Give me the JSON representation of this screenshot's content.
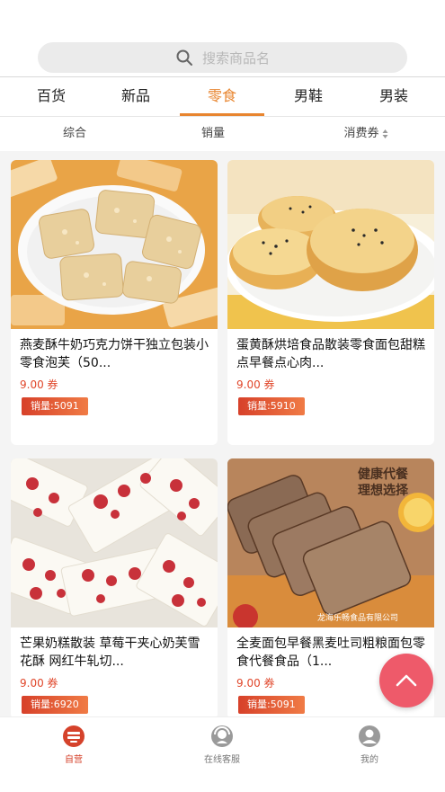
{
  "search": {
    "placeholder": "搜索商品名"
  },
  "tabs": [
    {
      "label": "百货"
    },
    {
      "label": "新品"
    },
    {
      "label": "零食",
      "active": true
    },
    {
      "label": "男鞋"
    },
    {
      "label": "男装"
    }
  ],
  "sort_options": [
    {
      "label": "综合"
    },
    {
      "label": "销量"
    },
    {
      "label": "消费券"
    }
  ],
  "products": [
    {
      "title": "燕麦酥牛奶巧克力饼干独立包装小零食泡芙（50...",
      "price": "9.00 券",
      "sales": "销量:5091"
    },
    {
      "title": "蛋黄酥烘培食品散装零食面包甜糕点早餐点心肉...",
      "price": "9.00 券",
      "sales": "销量:5910"
    },
    {
      "title": "芒果奶糕散装 草莓干夹心奶芙雪花酥 网红牛轧切...",
      "price": "9.00 券",
      "sales": "销量:6920"
    },
    {
      "title": "全麦面包早餐黑麦吐司粗粮面包零食代餐食品（1...",
      "price": "9.00 券",
      "sales": "销量:5091",
      "img_text_1": "健康代餐",
      "img_text_2": "理想选择",
      "img_watermark": "龙海乐畅食品有限公司"
    }
  ],
  "bottom_nav": [
    {
      "label": "自营",
      "icon": "store-icon",
      "active": true
    },
    {
      "label": "在线客服",
      "icon": "customer-service-icon"
    },
    {
      "label": "我的",
      "icon": "user-icon"
    }
  ],
  "colors": {
    "accent": "#e8852f",
    "price": "#e0462a",
    "fab": "#ee5a6a"
  }
}
